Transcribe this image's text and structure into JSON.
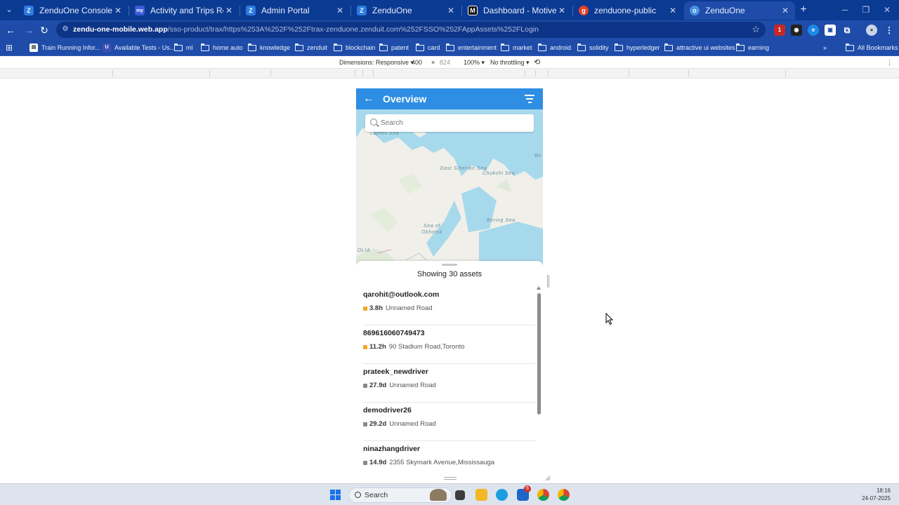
{
  "browser": {
    "tabs": [
      {
        "label": "ZenduOne Console",
        "favicon": "Z",
        "color": "#2d7be0"
      },
      {
        "label": "Activity and Trips Report | MyG",
        "favicon": "my",
        "color": "#3b5bd6"
      },
      {
        "label": "Admin Portal",
        "favicon": "Z",
        "color": "#2d7be0"
      },
      {
        "label": "ZenduOne",
        "favicon": "Z",
        "color": "#2d7be0"
      },
      {
        "label": "Dashboard - Motive",
        "favicon": "M",
        "color": "#111111"
      },
      {
        "label": "zenduone-public",
        "favicon": "g",
        "color": "#e24329"
      },
      {
        "label": "ZenduOne",
        "favicon": "o",
        "color": "#4a90e2"
      }
    ],
    "url_domain": "zendu-one-mobile.web.app",
    "url_path": "/sso-product/trax/https%253A%252F%252Ftrax-zenduone.zenduit.com%252FSSO%252FAppAssets%252FLogin",
    "bookmarks": [
      {
        "label": "Train Running Infor...",
        "icon": "train-icon"
      },
      {
        "label": "Available Tests - Us...",
        "icon": "u-icon"
      },
      {
        "label": "ml",
        "icon": "folder-icon"
      },
      {
        "label": "home auto",
        "icon": "folder-icon"
      },
      {
        "label": "knowledge",
        "icon": "folder-icon"
      },
      {
        "label": "zenduit",
        "icon": "folder-icon"
      },
      {
        "label": "blockchain",
        "icon": "folder-icon"
      },
      {
        "label": "patent",
        "icon": "folder-icon"
      },
      {
        "label": "card",
        "icon": "folder-icon"
      },
      {
        "label": "entertainment",
        "icon": "folder-icon"
      },
      {
        "label": "market",
        "icon": "folder-icon"
      },
      {
        "label": "android",
        "icon": "folder-icon"
      },
      {
        "label": "solidity",
        "icon": "folder-icon"
      },
      {
        "label": "hyperledger",
        "icon": "folder-icon"
      },
      {
        "label": "attractive ui websites",
        "icon": "folder-icon"
      },
      {
        "label": "earning",
        "icon": "folder-icon"
      }
    ],
    "all_bookmarks": "All Bookmarks",
    "extension_badge": "1"
  },
  "devtools": {
    "dimensions_label": "Dimensions: Responsive",
    "width": "400",
    "times": "×",
    "height": "824",
    "zoom": "100%",
    "throttling": "No throttling"
  },
  "app": {
    "title": "Overview",
    "search_placeholder": "Search",
    "map_labels": [
      "Laptev Sea",
      "East Siberian Sea",
      "Chukchi Sea",
      "Sea of Okhotsk",
      "Bering Sea",
      "OLIA",
      "Be"
    ],
    "showing_text": "Showing 30 assets",
    "assets": [
      {
        "name": "qarohit@outlook.com",
        "age": "3.8h",
        "location": "Unnamed Road",
        "status_color": "#f5a623"
      },
      {
        "name": "869616060749473",
        "age": "11.2h",
        "location": "90 Stadium Road,Toronto",
        "status_color": "#f5a623"
      },
      {
        "name": "prateek_newdriver",
        "age": "27.9d",
        "location": "Unnamed Road",
        "status_color": "#888888"
      },
      {
        "name": "demodriver26",
        "age": "29.2d",
        "location": "Unnamed Road",
        "status_color": "#888888"
      },
      {
        "name": "ninazhangdriver",
        "age": "14.9d",
        "location": "2355 Skymark Avenue,Mississauga",
        "status_color": "#888888"
      }
    ]
  },
  "taskbar": {
    "search_label": "Search",
    "mail_badge": "6",
    "time": "18:16",
    "date": "24-07-2025"
  }
}
